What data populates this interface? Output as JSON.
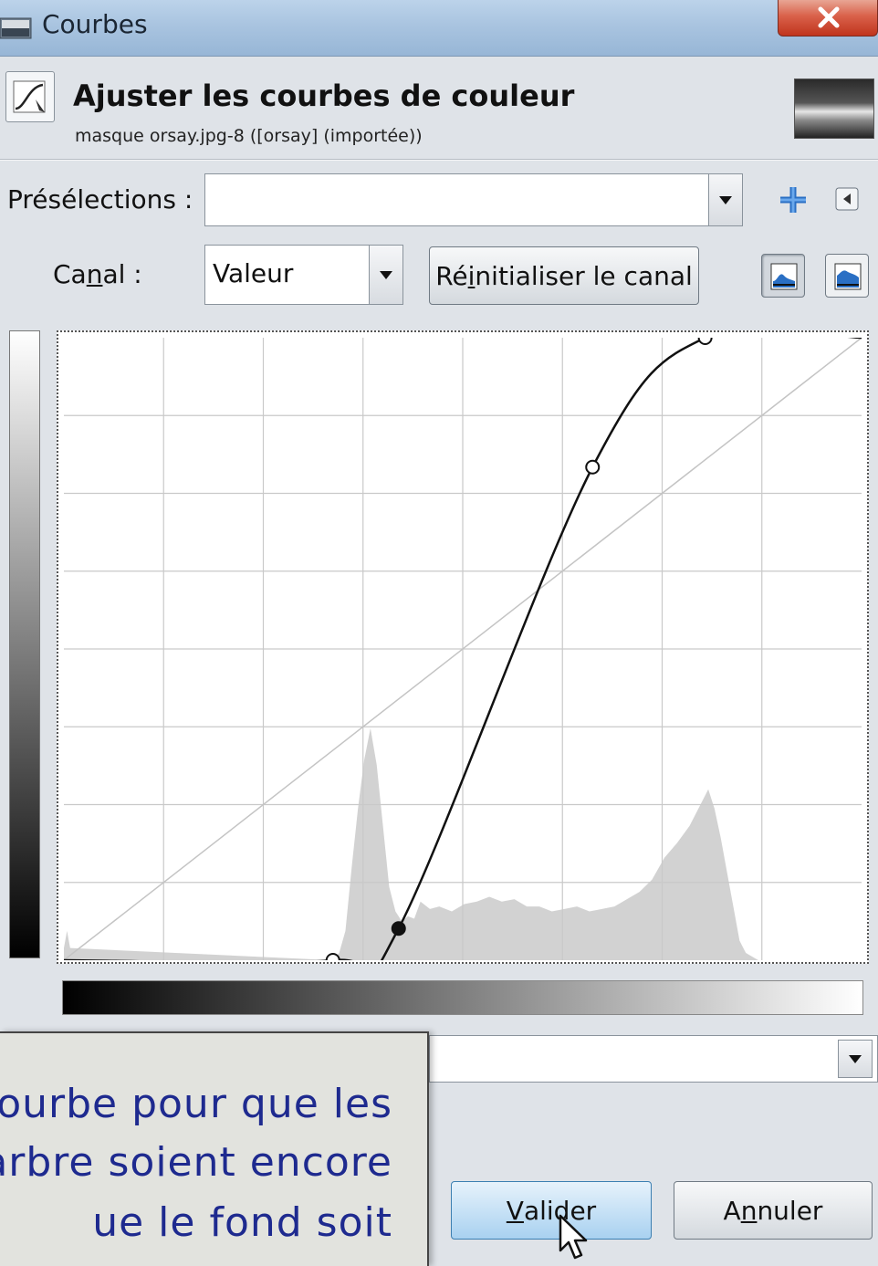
{
  "window": {
    "title": "Courbes",
    "title_icon": "curves-window-icon",
    "close_glyph": "X"
  },
  "header": {
    "title": "Ajuster les courbes de couleur",
    "subtitle": "masque orsay.jpg-8 ([orsay] (importée))",
    "icon": "curves-tool-icon",
    "thumbnail": "image-thumbnail"
  },
  "presets": {
    "label": "Présélections :",
    "value": "",
    "add_icon": "plus-icon",
    "menu_icon": "menu-arrow-icon"
  },
  "channel": {
    "label_before": "Ca",
    "label_mnemonic": "n",
    "label_after": "al :",
    "value": "Valeur",
    "reset_before": "Ré",
    "reset_mnemonic": "i",
    "reset_after": "nitialiser le canal",
    "linear_view_icon": "linear-histogram-icon",
    "log_view_icon": "logarithmic-histogram-icon"
  },
  "chart_data": {
    "type": "area",
    "xlim": [
      0,
      255
    ],
    "ylim": [
      0,
      255
    ],
    "grid": true,
    "grid_divisions": 8,
    "curve_control_points": [
      [
        0,
        0
      ],
      [
        86,
        0
      ],
      [
        107,
        13
      ],
      [
        169,
        202
      ],
      [
        205,
        255
      ],
      [
        255,
        255
      ]
    ],
    "selected_point": [
      107,
      13
    ],
    "histogram": [
      {
        "x": 0,
        "y": 5
      },
      {
        "x": 1,
        "y": 12
      },
      {
        "x": 2,
        "y": 5
      },
      {
        "x": 86,
        "y": 0
      },
      {
        "x": 88,
        "y": 3
      },
      {
        "x": 90,
        "y": 12
      },
      {
        "x": 92,
        "y": 38
      },
      {
        "x": 94,
        "y": 62
      },
      {
        "x": 96,
        "y": 82
      },
      {
        "x": 98,
        "y": 95
      },
      {
        "x": 100,
        "y": 80
      },
      {
        "x": 102,
        "y": 55
      },
      {
        "x": 104,
        "y": 30
      },
      {
        "x": 106,
        "y": 20
      },
      {
        "x": 108,
        "y": 16
      },
      {
        "x": 110,
        "y": 18
      },
      {
        "x": 112,
        "y": 17
      },
      {
        "x": 114,
        "y": 24
      },
      {
        "x": 117,
        "y": 21
      },
      {
        "x": 120,
        "y": 22
      },
      {
        "x": 124,
        "y": 20
      },
      {
        "x": 128,
        "y": 23
      },
      {
        "x": 132,
        "y": 24
      },
      {
        "x": 136,
        "y": 26
      },
      {
        "x": 140,
        "y": 24
      },
      {
        "x": 144,
        "y": 25
      },
      {
        "x": 148,
        "y": 22
      },
      {
        "x": 152,
        "y": 22
      },
      {
        "x": 156,
        "y": 20
      },
      {
        "x": 160,
        "y": 21
      },
      {
        "x": 164,
        "y": 22
      },
      {
        "x": 168,
        "y": 20
      },
      {
        "x": 172,
        "y": 21
      },
      {
        "x": 176,
        "y": 22
      },
      {
        "x": 180,
        "y": 25
      },
      {
        "x": 184,
        "y": 28
      },
      {
        "x": 188,
        "y": 33
      },
      {
        "x": 192,
        "y": 42
      },
      {
        "x": 196,
        "y": 48
      },
      {
        "x": 200,
        "y": 55
      },
      {
        "x": 204,
        "y": 65
      },
      {
        "x": 206,
        "y": 70
      },
      {
        "x": 208,
        "y": 62
      },
      {
        "x": 210,
        "y": 50
      },
      {
        "x": 212,
        "y": 36
      },
      {
        "x": 214,
        "y": 22
      },
      {
        "x": 216,
        "y": 8
      },
      {
        "x": 218,
        "y": 3
      },
      {
        "x": 222,
        "y": 0
      },
      {
        "x": 255,
        "y": 0
      }
    ],
    "colors": {
      "histogram": "#d2d2d2",
      "grid": "#c9c9c9",
      "curve": "#111111",
      "diagonal": "#c4c4c4"
    }
  },
  "tooltip": {
    "lines": [
      "ourbe pour que les",
      "arbre soient encore",
      "ue le fond soit"
    ]
  },
  "buttons": {
    "ok_before": "",
    "ok_mnemonic": "V",
    "ok_after": "alider",
    "cancel_before": "A",
    "cancel_mnemonic": "n",
    "cancel_after": "nuler"
  }
}
